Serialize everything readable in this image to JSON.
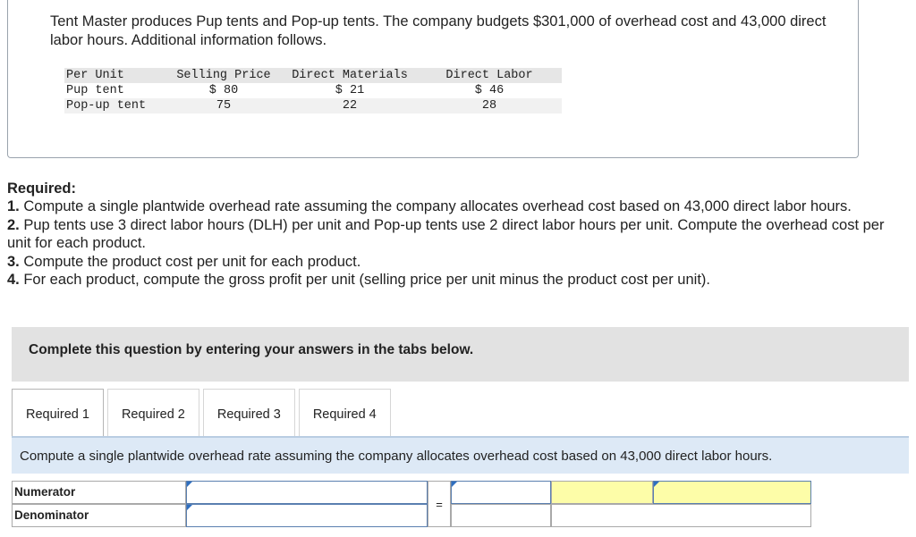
{
  "intro": "Tent Master produces Pup tents and Pop-up tents. The company budgets $301,000 of overhead cost and 43,000 direct labor hours. Additional information follows.",
  "table": {
    "headers": [
      "Per Unit",
      "Selling Price",
      "Direct Materials",
      "Direct Labor"
    ],
    "rows": [
      [
        "Pup tent",
        "$ 80",
        "$ 21",
        "$ 46"
      ],
      [
        "Pop-up tent",
        "75",
        "22",
        "28"
      ]
    ]
  },
  "required": {
    "title": "Required:",
    "items": [
      {
        "num": "1.",
        "text": " Compute a single plantwide overhead rate assuming the company allocates overhead cost based on 43,000 direct labor hours."
      },
      {
        "num": "2.",
        "text": " Pup tents use 3 direct labor hours (DLH) per unit and Pop-up tents use 2 direct labor hours per unit. Compute the overhead cost per unit for each product."
      },
      {
        "num": "3.",
        "text": " Compute the product cost per unit for each product."
      },
      {
        "num": "4.",
        "text": " For each product, compute the gross profit per unit (selling price per unit minus the product cost per unit)."
      }
    ]
  },
  "complete_text": "Complete this question by entering your answers in the tabs below.",
  "tabs": [
    "Required 1",
    "Required 2",
    "Required 3",
    "Required 4"
  ],
  "prompt": "Compute a single plantwide overhead rate assuming the company allocates overhead cost based on 43,000 direct labor hours.",
  "answer": {
    "numerator_label": "Numerator",
    "denominator_label": "Denominator",
    "equals": "="
  },
  "colors": {
    "highlight": "#fdfda8",
    "prompt_bg": "#dde9f6",
    "bar_bg": "#e2e2e2"
  }
}
